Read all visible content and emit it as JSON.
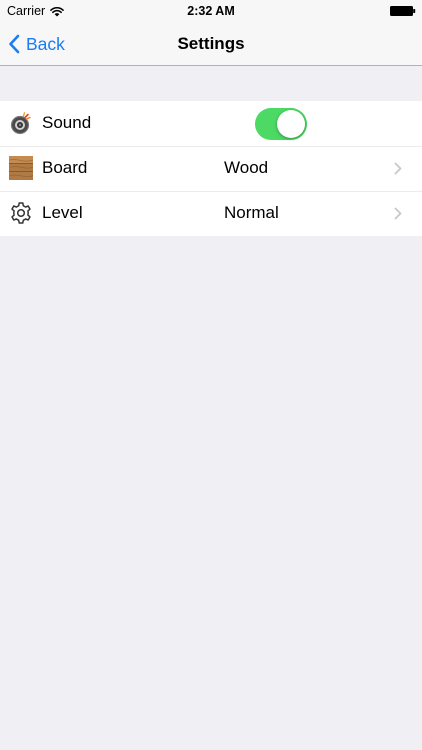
{
  "status_bar": {
    "carrier": "Carrier",
    "time": "2:32 AM"
  },
  "nav": {
    "back_label": "Back",
    "title": "Settings"
  },
  "settings": {
    "sound": {
      "label": "Sound",
      "enabled": true
    },
    "board": {
      "label": "Board",
      "value": "Wood"
    },
    "level": {
      "label": "Level",
      "value": "Normal"
    }
  },
  "colors": {
    "accent": "#1a7cf5",
    "switch_on": "#4cd964",
    "background": "#efeff4"
  },
  "icons": {
    "sound": "speaker-icon",
    "board": "wood-board-icon",
    "level": "gear-icon"
  }
}
